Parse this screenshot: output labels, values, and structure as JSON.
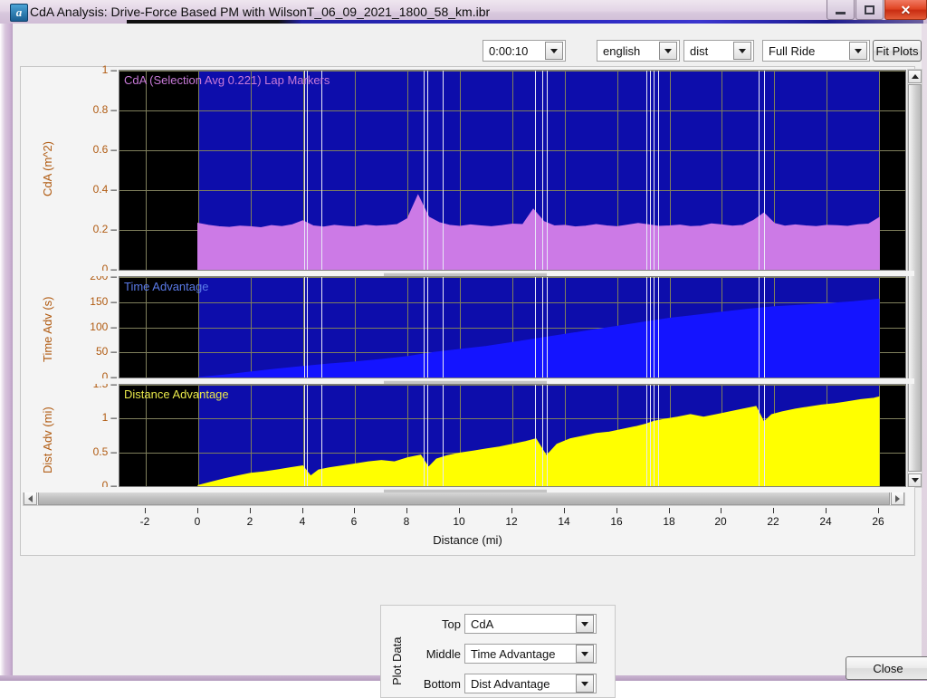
{
  "window": {
    "title": "CdA Analysis:  Drive-Force Based PM with WilsonT_06_09_2021_1800_58_km.ibr",
    "icon": "app-icon",
    "minimize_label": "–",
    "maximize_label": "❐",
    "close_label": "✕"
  },
  "toolbar": {
    "interval": {
      "value": "0:00:10"
    },
    "units": {
      "value": "english"
    },
    "xaxis_mode": {
      "value": "dist"
    },
    "range": {
      "value": "Full Ride"
    },
    "fit_plots_label": "Fit Plots"
  },
  "plot_data_group": {
    "group_label": "Plot Data",
    "top_label": "Top",
    "top_value": "CdA",
    "middle_label": "Middle",
    "middle_value": "Time Advantage",
    "bottom_label": "Bottom",
    "bottom_value": "Dist Advantage"
  },
  "footer": {
    "close_label": "Close"
  },
  "chart_data": [
    {
      "type": "area",
      "id": "cda",
      "title": "CdA (Selection Avg 0.221) Lap Markers",
      "selection_avg": 0.221,
      "ylabel": "CdA (m^2)",
      "xlabel": "Distance (mi)",
      "ylim": [
        0,
        1
      ],
      "yticks": [
        0,
        0.2,
        0.4,
        0.6,
        0.8,
        1
      ],
      "ytick_labels": [
        "0",
        "0.2",
        "0.4",
        "0.6",
        "0.8",
        "1"
      ],
      "xlim": [
        -3,
        27
      ],
      "series_color": "#cc7ae6",
      "background": "#0d0dab",
      "grid": true,
      "x": [
        0,
        0.4,
        0.8,
        1.2,
        1.6,
        2,
        2.4,
        2.8,
        3.2,
        3.6,
        4,
        4.4,
        4.8,
        5.2,
        5.6,
        6,
        6.4,
        6.8,
        7.2,
        7.6,
        8,
        8.4,
        8.8,
        9.2,
        9.6,
        10,
        10.4,
        10.8,
        11.2,
        11.6,
        12,
        12.4,
        12.8,
        13.2,
        13.6,
        14,
        14.4,
        14.8,
        15.2,
        15.6,
        16,
        16.4,
        16.8,
        17.2,
        17.6,
        18,
        18.4,
        18.8,
        19.2,
        19.6,
        20,
        20.4,
        20.8,
        21.2,
        21.6,
        22,
        22.4,
        22.8,
        23.2,
        23.6,
        24,
        24.4,
        24.8,
        25.2,
        25.6,
        26
      ],
      "values": [
        0.232,
        0.222,
        0.215,
        0.212,
        0.218,
        0.215,
        0.21,
        0.221,
        0.216,
        0.225,
        0.245,
        0.219,
        0.213,
        0.222,
        0.217,
        0.214,
        0.223,
        0.218,
        0.221,
        0.226,
        0.256,
        0.372,
        0.264,
        0.236,
        0.222,
        0.217,
        0.224,
        0.219,
        0.215,
        0.221,
        0.228,
        0.226,
        0.302,
        0.241,
        0.219,
        0.222,
        0.214,
        0.218,
        0.226,
        0.219,
        0.215,
        0.223,
        0.232,
        0.225,
        0.217,
        0.219,
        0.223,
        0.216,
        0.218,
        0.229,
        0.224,
        0.218,
        0.222,
        0.246,
        0.283,
        0.232,
        0.218,
        0.224,
        0.219,
        0.216,
        0.222,
        0.22,
        0.217,
        0.225,
        0.228,
        0.26
      ]
    },
    {
      "type": "area",
      "id": "time_advantage",
      "title": "Time Advantage",
      "ylabel": "Time Adv (s)",
      "xlabel": "Distance (mi)",
      "ylim": [
        0,
        200
      ],
      "yticks": [
        0,
        50,
        100,
        150,
        200
      ],
      "ytick_labels": [
        "0",
        "50",
        "100",
        "150",
        "200"
      ],
      "xlim": [
        -3,
        27
      ],
      "series_color": "#1414ff",
      "background": "#0d0dab",
      "grid": true,
      "x": [
        0,
        1,
        2,
        3,
        4,
        5,
        6,
        7,
        8,
        9,
        10,
        11,
        12,
        13,
        14,
        15,
        16,
        17,
        18,
        19,
        20,
        21,
        22,
        23,
        24,
        25,
        26
      ],
      "values": [
        0,
        5,
        11,
        17,
        22,
        27,
        31,
        36,
        42,
        50,
        56,
        62,
        70,
        78,
        86,
        94,
        102,
        110,
        118,
        124,
        130,
        136,
        141,
        144,
        147,
        151,
        156
      ]
    },
    {
      "type": "area",
      "id": "dist_advantage",
      "title": "Distance Advantage",
      "ylabel": "Dist Adv (mi)",
      "xlabel": "Distance (mi)",
      "ylim": [
        0,
        1.5
      ],
      "yticks": [
        0,
        0.5,
        1,
        1.5
      ],
      "ytick_labels": [
        "0",
        "0.5",
        "1",
        "1.5"
      ],
      "xlim": [
        -3,
        27
      ],
      "series_color": "#ffff00",
      "background": "#0d0dab",
      "grid": true,
      "x": [
        0,
        0.5,
        1,
        1.5,
        2,
        2.5,
        3,
        3.5,
        4,
        4.3,
        4.6,
        5,
        5.5,
        6,
        6.5,
        7,
        7.5,
        8,
        8.5,
        8.8,
        9.1,
        9.5,
        10,
        10.5,
        11,
        11.5,
        12,
        12.5,
        12.9,
        13.3,
        13.7,
        14.2,
        14.7,
        15.2,
        15.7,
        16.2,
        16.7,
        17.1,
        17.4,
        17.8,
        18.3,
        18.8,
        19.3,
        19.8,
        20.3,
        20.8,
        21.3,
        21.6,
        21.9,
        22.3,
        22.8,
        23.3,
        23.8,
        24.3,
        24.8,
        25.3,
        25.8,
        26
      ],
      "values": [
        0.01,
        0.06,
        0.11,
        0.15,
        0.19,
        0.21,
        0.24,
        0.27,
        0.3,
        0.15,
        0.24,
        0.27,
        0.3,
        0.33,
        0.36,
        0.38,
        0.36,
        0.42,
        0.46,
        0.28,
        0.4,
        0.45,
        0.49,
        0.52,
        0.55,
        0.58,
        0.62,
        0.66,
        0.7,
        0.45,
        0.62,
        0.7,
        0.74,
        0.78,
        0.8,
        0.84,
        0.88,
        0.92,
        0.96,
        0.99,
        1.02,
        1.06,
        1.02,
        1.06,
        1.1,
        1.14,
        1.18,
        0.95,
        1.06,
        1.1,
        1.14,
        1.17,
        1.2,
        1.22,
        1.25,
        1.28,
        1.3,
        1.32
      ]
    }
  ],
  "axes": {
    "x_ticks": [
      "-2",
      "0",
      "2",
      "4",
      "6",
      "8",
      "10",
      "12",
      "14",
      "16",
      "18",
      "20",
      "22",
      "24",
      "26"
    ],
    "x_label": "Distance (mi)"
  },
  "lap_markers": [
    4.05,
    4.15,
    4.7,
    8.6,
    8.75,
    9.35,
    12.85,
    13.15,
    13.3,
    17.1,
    17.25,
    17.4,
    17.55,
    21.4,
    21.6
  ],
  "scrollbars": {
    "vertical_up": "▲",
    "vertical_down": "▼",
    "horizontal_left": "◀",
    "horizontal_right": "▶"
  }
}
